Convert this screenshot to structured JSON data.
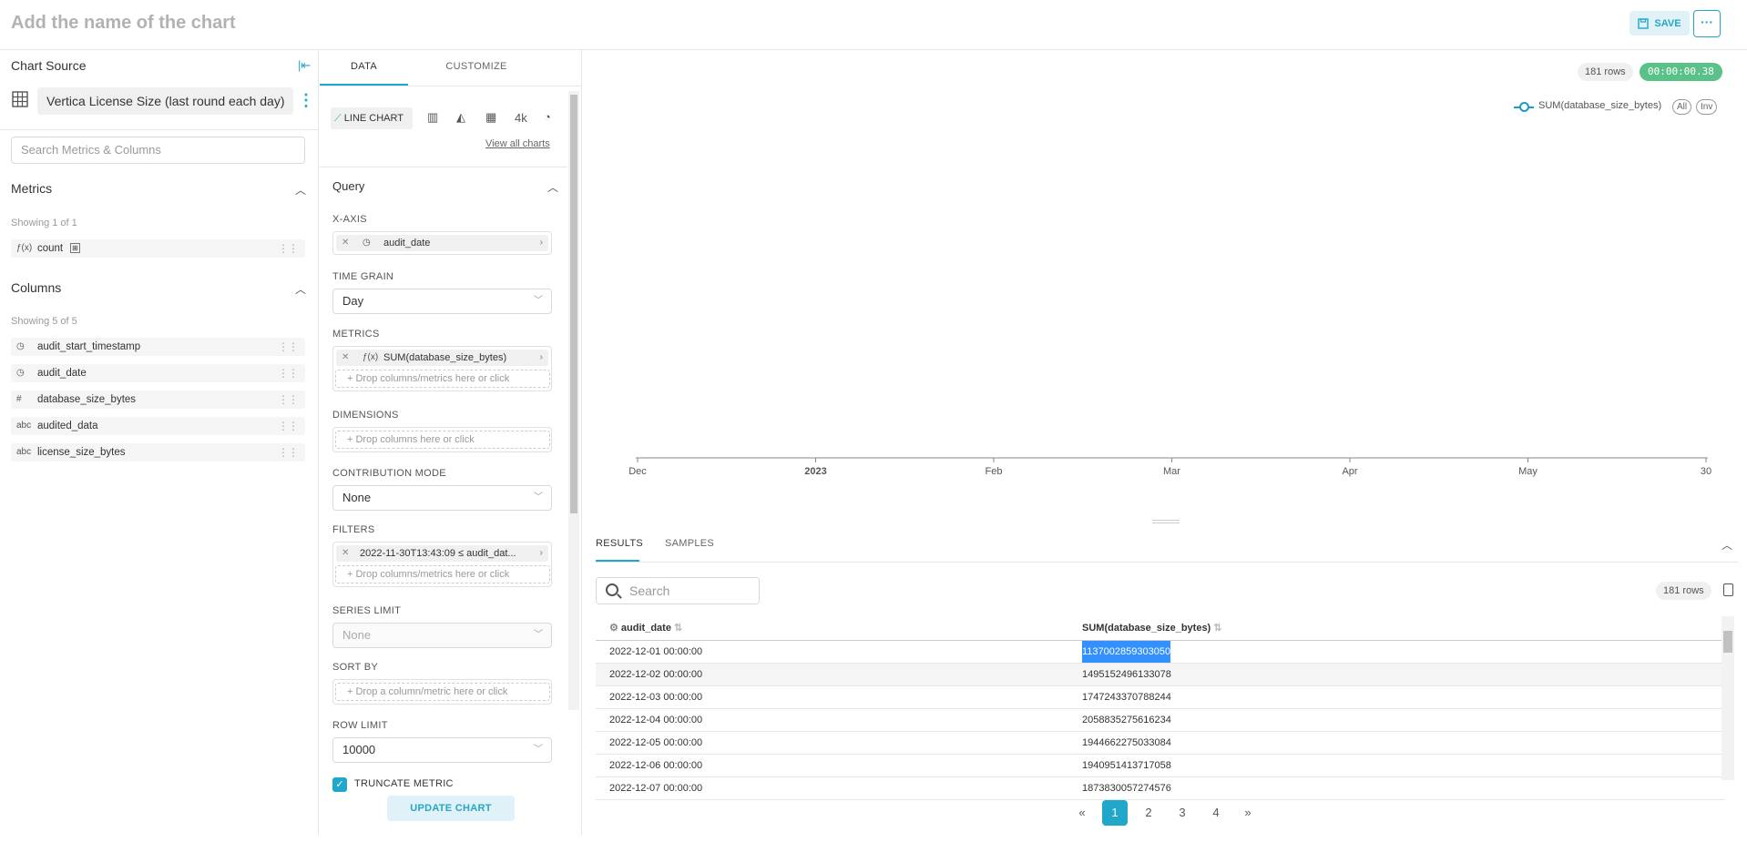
{
  "header": {
    "title_placeholder": "Add the name of the chart",
    "save_label": "SAVE",
    "more_label": "···"
  },
  "source_panel": {
    "title": "Chart Source",
    "dataset_name": "Vertica License Size (last round each day)",
    "search_placeholder": "Search Metrics & Columns",
    "metrics": {
      "heading": "Metrics",
      "showing": "Showing 1 of 1",
      "items": [
        {
          "icon": "ƒ(x)",
          "label": "count"
        }
      ]
    },
    "columns": {
      "heading": "Columns",
      "showing": "Showing 5 of 5",
      "items": [
        {
          "icon": "clock",
          "label": "audit_start_timestamp"
        },
        {
          "icon": "clock",
          "label": "audit_date"
        },
        {
          "icon": "#",
          "label": "database_size_bytes"
        },
        {
          "icon": "abc",
          "label": "audited_data"
        },
        {
          "icon": "abc",
          "label": "license_size_bytes"
        }
      ]
    }
  },
  "control_panel": {
    "tabs": [
      "DATA",
      "CUSTOMIZE"
    ],
    "viz_selected": "LINE CHART",
    "viz_4k": "4k",
    "view_all": "View all charts",
    "query_heading": "Query",
    "x_axis_label": "X-AXIS",
    "x_axis_value": "audit_date",
    "time_grain_label": "TIME GRAIN",
    "time_grain_value": "Day",
    "metrics_label": "METRICS",
    "metric_value": "SUM(database_size_bytes)",
    "drop_metrics": "Drop columns/metrics here or click",
    "dimensions_label": "DIMENSIONS",
    "drop_dimensions": "Drop columns here or click",
    "contribution_label": "CONTRIBUTION MODE",
    "contribution_value": "None",
    "filters_label": "FILTERS",
    "filter_value": "2022-11-30T13:43:09 ≤ audit_dat...",
    "drop_filters": "Drop columns/metrics here or click",
    "series_limit_label": "SERIES LIMIT",
    "series_limit_value": "None",
    "sort_by_label": "SORT BY",
    "drop_sort": "Drop a column/metric here or click",
    "row_limit_label": "ROW LIMIT",
    "row_limit_value": "10000",
    "truncate_label": "TRUNCATE METRIC",
    "update_label": "UPDATE CHART"
  },
  "results_panel": {
    "row_count": "181 rows",
    "query_time": "00:00:00.38",
    "legend": {
      "series": "SUM(database_size_bytes)",
      "all": "All",
      "inv": "Inv"
    },
    "tabs": [
      "RESULTS",
      "SAMPLES"
    ],
    "search_placeholder": "Search",
    "columns": [
      "audit_date",
      "SUM(database_size_bytes)"
    ],
    "rows": [
      [
        "2022-12-01 00:00:00",
        "1137002859303050"
      ],
      [
        "2022-12-02 00:00:00",
        "1495152496133078"
      ],
      [
        "2022-12-03 00:00:00",
        "1747243370788244"
      ],
      [
        "2022-12-04 00:00:00",
        "2058835275616234"
      ],
      [
        "2022-12-05 00:00:00",
        "1944662275033084"
      ],
      [
        "2022-12-06 00:00:00",
        "1940951413717058"
      ],
      [
        "2022-12-07 00:00:00",
        "1873830057274576"
      ]
    ],
    "pagination": [
      "«",
      "1",
      "2",
      "3",
      "4",
      "»"
    ],
    "active_page": "1"
  },
  "chart_data": {
    "type": "line",
    "series": [
      {
        "name": "SUM(database_size_bytes)",
        "values": []
      }
    ],
    "x_ticks": [
      "Dec",
      "2023",
      "Feb",
      "Mar",
      "Apr",
      "May",
      "30"
    ]
  },
  "colors": {
    "accent": "#20a7c9",
    "success": "#5ac189",
    "series": "#1f9ac4"
  }
}
